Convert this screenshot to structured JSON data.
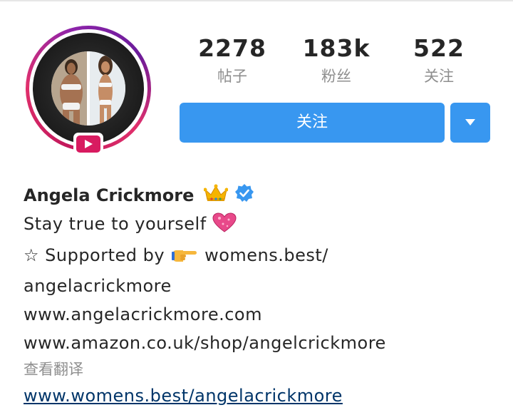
{
  "profile": {
    "display_name": "Angela Crickmore",
    "name_emoji": "crown-icon",
    "verified_icon": "verified-badge-icon",
    "video_badge_icon": "play-icon"
  },
  "stats": [
    {
      "value": "2278",
      "label": "帖子"
    },
    {
      "value": "183k",
      "label": "粉丝"
    },
    {
      "value": "522",
      "label": "关注"
    }
  ],
  "actions": {
    "follow_label": "关注",
    "dropdown_icon": "caret-down-icon"
  },
  "bio": {
    "line1_text": "Stay true to yourself",
    "line1_emoji": "heart-icon",
    "line2_prefix": "☆ Supported by",
    "line2_emoji": "pointing-hand-icon",
    "line2_suffix": "womens.best/",
    "line3": "angelacrickmore",
    "line4": "www.angelacrickmore.com",
    "line5": "www.amazon.co.uk/shop/angelcrickmore",
    "translate_label": "查看翻译",
    "link": "www.womens.best/angelacrickmore"
  },
  "colors": {
    "primary_blue": "#3897f0",
    "ring_pink": "#e1306c",
    "ring_purple": "#8e24aa",
    "badge_pink": "#d81b60",
    "muted_text": "#8e8e8e",
    "link_text": "#003569",
    "verified_blue": "#3897f0"
  }
}
